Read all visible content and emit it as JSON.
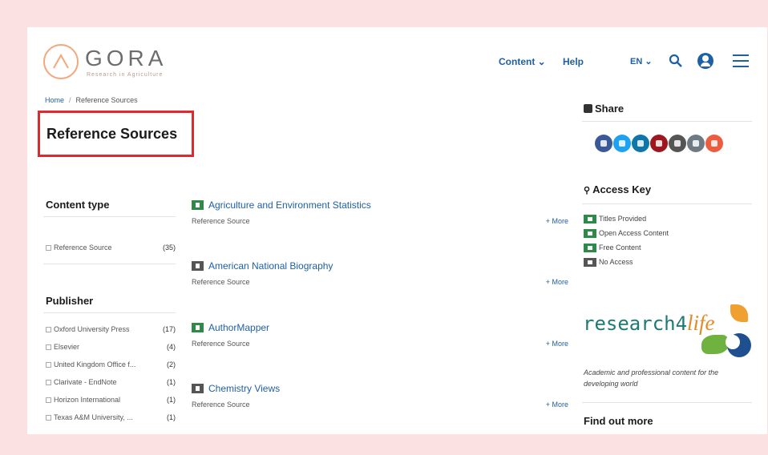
{
  "logo": {
    "word": "GORA",
    "tagline": "Research in Agriculture"
  },
  "nav": {
    "content_label": "Content",
    "content_caret": "⌄",
    "help_label": "Help",
    "lang_label": "EN",
    "lang_caret": "⌄"
  },
  "breadcrumb": {
    "home": "Home",
    "separator": "/",
    "current": "Reference Sources"
  },
  "page_title": "Reference Sources",
  "facets": {
    "content_type": {
      "heading": "Content type",
      "items": [
        {
          "label": "Reference Source",
          "count": "(35)"
        }
      ]
    },
    "publisher": {
      "heading": "Publisher",
      "items": [
        {
          "label": "Oxford University Press",
          "count": "(17)"
        },
        {
          "label": "Elsevier",
          "count": "(4)"
        },
        {
          "label": "United Kingdom Office f...",
          "count": "(2)"
        },
        {
          "label": "Clarivate - EndNote",
          "count": "(1)"
        },
        {
          "label": "Horizon International",
          "count": "(1)"
        },
        {
          "label": "Texas A&M University, ...",
          "count": "(1)"
        }
      ]
    }
  },
  "results": [
    {
      "title": "Agriculture and Environment Statistics",
      "type": "Reference Source",
      "more": "+ More",
      "access": "green"
    },
    {
      "title": "American National Biography",
      "type": "Reference Source",
      "more": "+ More",
      "access": "grey"
    },
    {
      "title": "AuthorMapper",
      "type": "Reference Source",
      "more": "+ More",
      "access": "green"
    },
    {
      "title": "Chemistry Views",
      "type": "Reference Source",
      "more": "+ More",
      "access": "grey"
    }
  ],
  "share": {
    "heading": "Share",
    "icons": [
      {
        "name": "facebook-icon",
        "color": "#3b5998"
      },
      {
        "name": "twitter-icon",
        "color": "#1da1f2"
      },
      {
        "name": "linkedin-icon",
        "color": "#0e76a8"
      },
      {
        "name": "mendeley-icon",
        "color": "#9d1620"
      },
      {
        "name": "print-icon",
        "color": "#555555"
      },
      {
        "name": "email-icon",
        "color": "#6f7b84"
      },
      {
        "name": "more-share-icon",
        "color": "#ef5b3d"
      }
    ]
  },
  "access_key": {
    "heading": "Access Key",
    "items": [
      {
        "label": "Titles Provided",
        "color": "green"
      },
      {
        "label": "Open Access Content",
        "color": "green"
      },
      {
        "label": "Free Content",
        "color": "green"
      },
      {
        "label": "No Access",
        "color": "grey"
      }
    ]
  },
  "r4l": {
    "brand_main": "research4",
    "brand_life": "life",
    "description": "Academic and professional content for the developing world"
  },
  "find_more": "Find out more",
  "colors": {
    "accent": "#1f5fa6",
    "highlight_box": "#e0292f",
    "frame": "#fbe1e1",
    "access_green": "#2f8a4a",
    "access_grey": "#555555"
  }
}
